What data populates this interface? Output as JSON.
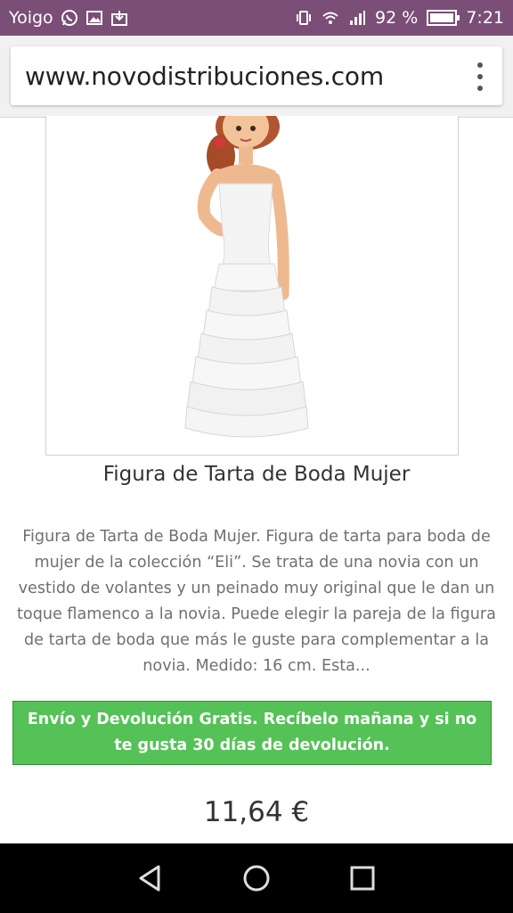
{
  "status_bar": {
    "carrier": "Yoigo",
    "battery": "92 %",
    "time": "7:21"
  },
  "browser": {
    "url": "www.novodistribuciones.com"
  },
  "product": {
    "title": "Figura de Tarta de Boda Mujer",
    "description": "Figura de Tarta de Boda Mujer. Figura de tarta para boda de mujer de la colección “Eli”. Se trata de una novia con un vestido de volantes y un peinado muy original que le dan un toque flamenco a la novia. Puede elegir la pareja de la figura de tarta de boda que más le guste para complementar a la novia. Medido: 16 cm. Esta...",
    "shipping_notice": "Envío y Devolución Gratis. Recíbelo mañana y si no te gusta 30 días de devolución.",
    "price": "11,64 €"
  },
  "colors": {
    "status_bar": "#7a4e76",
    "shipping_green": "#54c257"
  }
}
